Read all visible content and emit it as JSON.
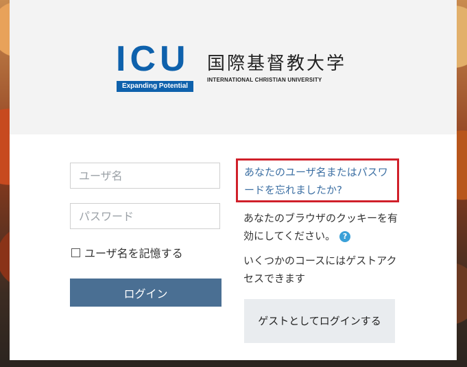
{
  "header": {
    "logo_mark": "ICU",
    "logo_tagline": "Expanding Potential",
    "logo_japanese": "国際基督教大学",
    "logo_english": "INTERNATIONAL CHRISTIAN UNIVERSITY"
  },
  "login": {
    "username_placeholder": "ユーザ名",
    "password_placeholder": "パスワード",
    "remember_label": "ユーザ名を記憶する",
    "login_button": "ログイン"
  },
  "side": {
    "forgot_link": "あなたのユーザ名またはパスワードを忘れましたか?",
    "cookie_text": "あなたのブラウザのクッキーを有効にしてください。",
    "help_icon": "question-icon",
    "help_glyph": "?",
    "guest_text": "いくつかのコースにはゲストアクセスできます",
    "guest_button": "ゲストとしてログインする"
  },
  "colors": {
    "brand_blue": "#0e61ac",
    "login_button": "#4a6f93",
    "link": "#3c6fa3",
    "highlight_border": "#d0202a"
  }
}
